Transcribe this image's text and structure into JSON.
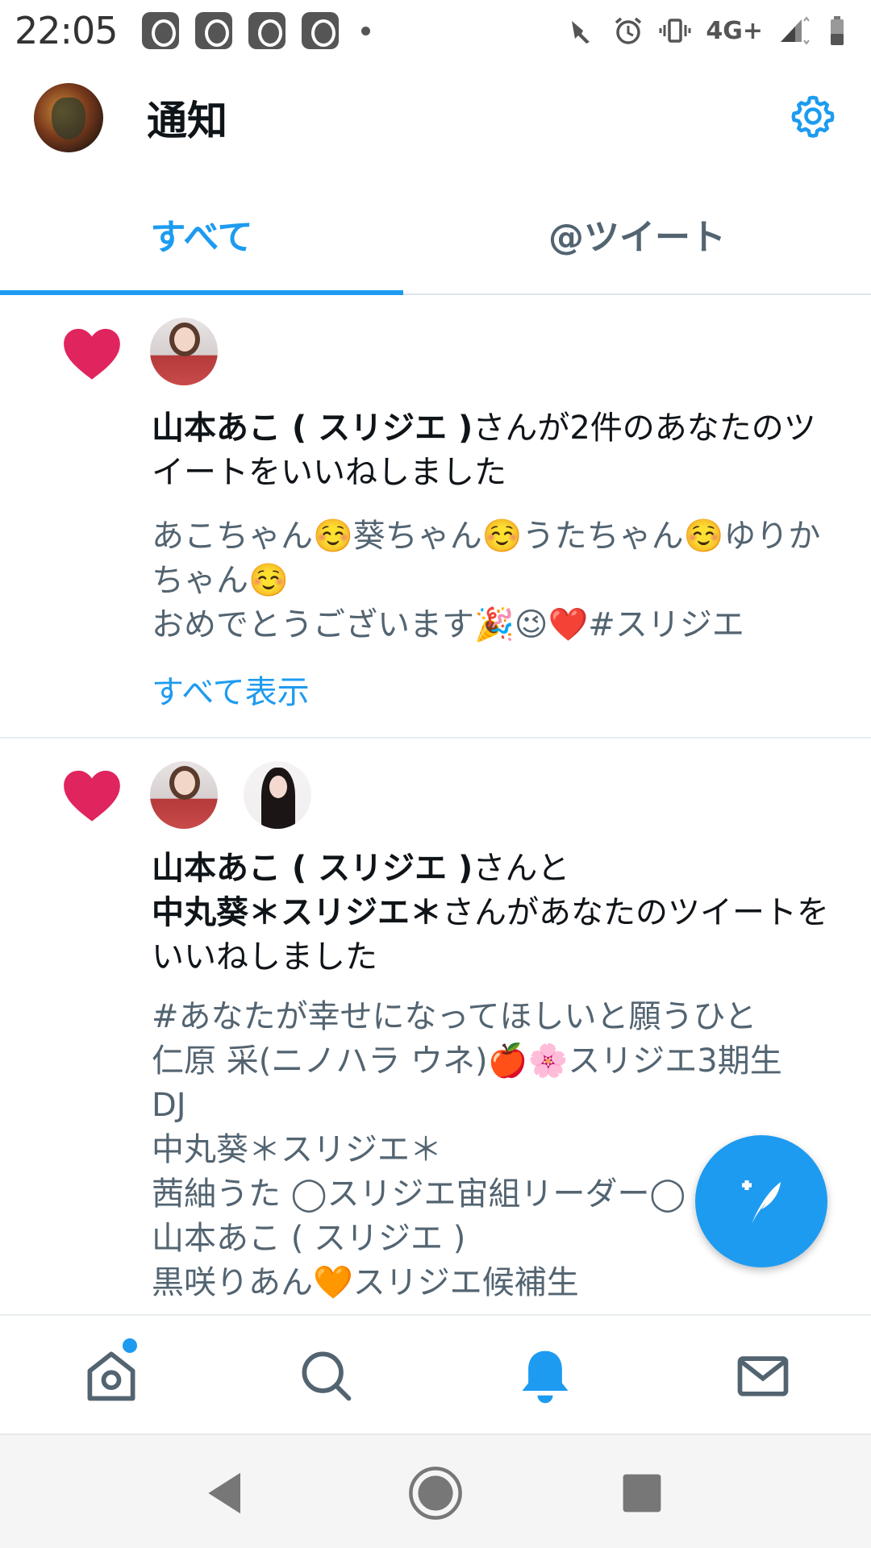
{
  "status_bar": {
    "time": "22:05",
    "network": "4G+",
    "icons": [
      "notification-icon",
      "notification-icon",
      "notification-icon",
      "notification-icon",
      "hand-icon",
      "alarm-icon",
      "vibrate-icon",
      "signal-icon",
      "battery-icon"
    ]
  },
  "header": {
    "title": "通知",
    "settings_icon": "gear-icon"
  },
  "tabs": [
    {
      "label": "すべて",
      "active": true
    },
    {
      "label": "@ツイート",
      "active": false
    }
  ],
  "notifications": [
    {
      "type": "like",
      "actor_1": "山本あこ ( スリジエ )",
      "rest_1": "さんが2件のあなたのツイートをいいねしました",
      "tweet_text": "あこちゃん☺️葵ちゃん☺️うたちゃん☺️ゆりかちゃん☺️\nおめでとうございます🎉😉❤️#スリジエ",
      "show_all": "すべて表示"
    },
    {
      "type": "like",
      "actor_1": "山本あこ ( スリジエ )",
      "join": "さんと",
      "actor_2": "中丸葵＊スリジエ＊",
      "rest_2": "さんがあなたのツイートをいいねしました",
      "tweet_text": "#あなたが幸せになってほしいと願うひと\n仁原 采(ニノハラ ウネ)🍎🌸スリジエ3期生\nDJ\n中丸葵＊スリジエ＊\n茜紬うた ◯スリジエ宙組リーダー◯\n山本あこ ( スリジエ )\n黒咲りあん🧡スリジエ候補生"
    }
  ],
  "colors": {
    "accent": "#1d9bf0",
    "like": "#e0245e",
    "muted_text": "#536471"
  },
  "bottom_nav": [
    "home-icon",
    "search-icon",
    "bell-icon",
    "mail-icon"
  ]
}
